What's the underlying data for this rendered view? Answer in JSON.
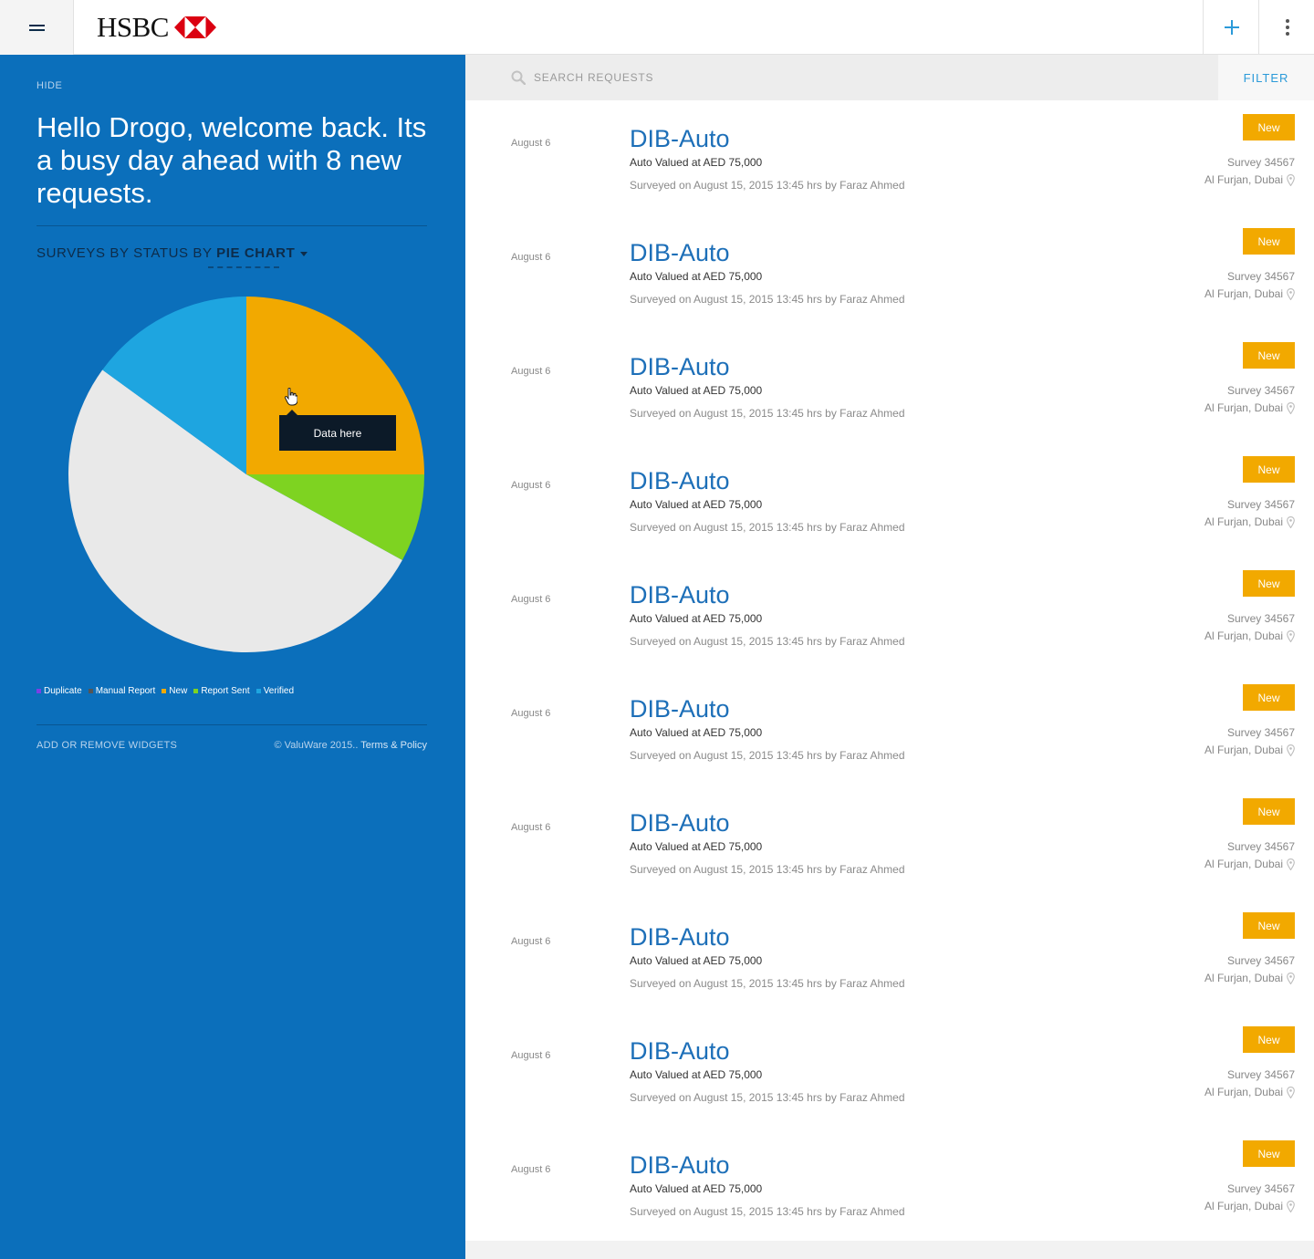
{
  "brand": {
    "name": "HSBC"
  },
  "sidebar": {
    "hide_label": "HIDE",
    "welcome_text": "Hello Drogo, welcome back. Its a busy day ahead with 8 new requests.",
    "chart_heading_prefix": "SURVEYS BY STATUS BY ",
    "chart_heading_type": "PIE CHART",
    "tooltip_text": "Data here",
    "add_widgets_label": "ADD OR REMOVE WIDGETS",
    "copyright": "© ValuWare 2015.. ",
    "terms_label": "Terms & Policy"
  },
  "chart_data": {
    "type": "pie",
    "labels": [
      "Duplicate",
      "Manual Report",
      "New",
      "Report Sent",
      "Verified"
    ],
    "values": [
      0,
      0,
      25,
      8,
      52,
      15
    ],
    "slices": [
      {
        "label": "New",
        "value": 25,
        "color": "#f2a900"
      },
      {
        "label": "Report Sent",
        "value": 8,
        "color": "#7ed321"
      },
      {
        "label": "",
        "value": 52,
        "color": "#e9e9e9"
      },
      {
        "label": "Verified",
        "value": 15,
        "color": "#1ea5e0"
      }
    ],
    "legend": [
      {
        "label": "Duplicate",
        "color": "#7b3fe4"
      },
      {
        "label": "Manual Report",
        "color": "#555555"
      },
      {
        "label": "New",
        "color": "#f2a900"
      },
      {
        "label": "Report Sent",
        "color": "#7ed321"
      },
      {
        "label": "Verified",
        "color": "#1ea5e0"
      }
    ],
    "legend_position": "bottom-left"
  },
  "search": {
    "placeholder": "SEARCH REQUESTS",
    "filter_label": "FILTER"
  },
  "requests": [
    {
      "date": "August 6",
      "title": "DIB-Auto",
      "value": "Auto Valued at AED 75,000",
      "surveyed": "Surveyed on August 15, 2015 13:45 hrs by Faraz Ahmed",
      "status": "New",
      "survey": "Survey 34567",
      "location": "Al Furjan, Dubai"
    },
    {
      "date": "August 6",
      "title": "DIB-Auto",
      "value": "Auto Valued at AED 75,000",
      "surveyed": "Surveyed on August 15, 2015 13:45 hrs by Faraz Ahmed",
      "status": "New",
      "survey": "Survey 34567",
      "location": "Al Furjan, Dubai"
    },
    {
      "date": "August 6",
      "title": "DIB-Auto",
      "value": "Auto Valued at AED 75,000",
      "surveyed": "Surveyed on August 15, 2015 13:45 hrs by Faraz Ahmed",
      "status": "New",
      "survey": "Survey 34567",
      "location": "Al Furjan, Dubai"
    },
    {
      "date": "August 6",
      "title": "DIB-Auto",
      "value": "Auto Valued at AED 75,000",
      "surveyed": "Surveyed on August 15, 2015 13:45 hrs by Faraz Ahmed",
      "status": "New",
      "survey": "Survey 34567",
      "location": "Al Furjan, Dubai"
    },
    {
      "date": "August 6",
      "title": "DIB-Auto",
      "value": "Auto Valued at AED 75,000",
      "surveyed": "Surveyed on August 15, 2015 13:45 hrs by Faraz Ahmed",
      "status": "New",
      "survey": "Survey 34567",
      "location": "Al Furjan, Dubai"
    },
    {
      "date": "August 6",
      "title": "DIB-Auto",
      "value": "Auto Valued at AED 75,000",
      "surveyed": "Surveyed on August 15, 2015 13:45 hrs by Faraz Ahmed",
      "status": "New",
      "survey": "Survey 34567",
      "location": "Al Furjan, Dubai"
    },
    {
      "date": "August 6",
      "title": "DIB-Auto",
      "value": "Auto Valued at AED 75,000",
      "surveyed": "Surveyed on August 15, 2015 13:45 hrs by Faraz Ahmed",
      "status": "New",
      "survey": "Survey 34567",
      "location": "Al Furjan, Dubai"
    },
    {
      "date": "August 6",
      "title": "DIB-Auto",
      "value": "Auto Valued at AED 75,000",
      "surveyed": "Surveyed on August 15, 2015 13:45 hrs by Faraz Ahmed",
      "status": "New",
      "survey": "Survey 34567",
      "location": "Al Furjan, Dubai"
    },
    {
      "date": "August 6",
      "title": "DIB-Auto",
      "value": "Auto Valued at AED 75,000",
      "surveyed": "Surveyed on August 15, 2015 13:45 hrs by Faraz Ahmed",
      "status": "New",
      "survey": "Survey 34567",
      "location": "Al Furjan, Dubai"
    },
    {
      "date": "August 6",
      "title": "DIB-Auto",
      "value": "Auto Valued at AED 75,000",
      "surveyed": "Surveyed on August 15, 2015 13:45 hrs by Faraz Ahmed",
      "status": "New",
      "survey": "Survey 34567",
      "location": "Al Furjan, Dubai"
    }
  ],
  "colors": {
    "sidebar": "#0b6fbb",
    "accent": "#2b9ad9",
    "title_link": "#1d6fb8",
    "badge_new": "#f2a900",
    "brand_red": "#db0011"
  },
  "icons": {
    "menu": "hamburger-icon",
    "add": "plus-icon",
    "more": "kebab-icon",
    "search": "search-icon",
    "location": "map-pin-icon",
    "cursor": "hand-cursor-icon"
  }
}
